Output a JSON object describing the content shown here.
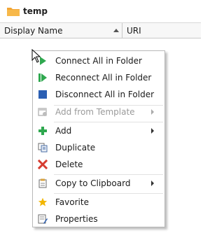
{
  "window": {
    "title": "temp"
  },
  "grid": {
    "columns": [
      "Display Name",
      "URI"
    ]
  },
  "context_menu": {
    "items": [
      {
        "label": "Connect All in Folder",
        "icon": "connect-play-icon",
        "disabled": false,
        "submenu": false
      },
      {
        "label": "Reconnect All in Folder",
        "icon": "reconnect-icon",
        "disabled": false,
        "submenu": false
      },
      {
        "label": "Disconnect All in Folder",
        "icon": "disconnect-stop-icon",
        "disabled": false,
        "submenu": false
      },
      {
        "label": "Add from Template",
        "icon": "template-icon",
        "disabled": true,
        "submenu": true
      },
      {
        "label": "Add",
        "icon": "plus-icon",
        "disabled": false,
        "submenu": true
      },
      {
        "label": "Duplicate",
        "icon": "duplicate-icon",
        "disabled": false,
        "submenu": false
      },
      {
        "label": "Delete",
        "icon": "delete-x-icon",
        "disabled": false,
        "submenu": false
      },
      {
        "label": "Copy to Clipboard",
        "icon": "clipboard-icon",
        "disabled": false,
        "submenu": true
      },
      {
        "label": "Favorite",
        "icon": "star-icon",
        "disabled": false,
        "submenu": false
      },
      {
        "label": "Properties",
        "icon": "properties-icon",
        "disabled": false,
        "submenu": false
      }
    ]
  },
  "colors": {
    "connect_green": "#2fa84f",
    "disconnect_blue": "#2b5fb3",
    "delete_red": "#d63b2f",
    "folder_orange": "#f2a534",
    "star_yellow": "#f2b600"
  }
}
